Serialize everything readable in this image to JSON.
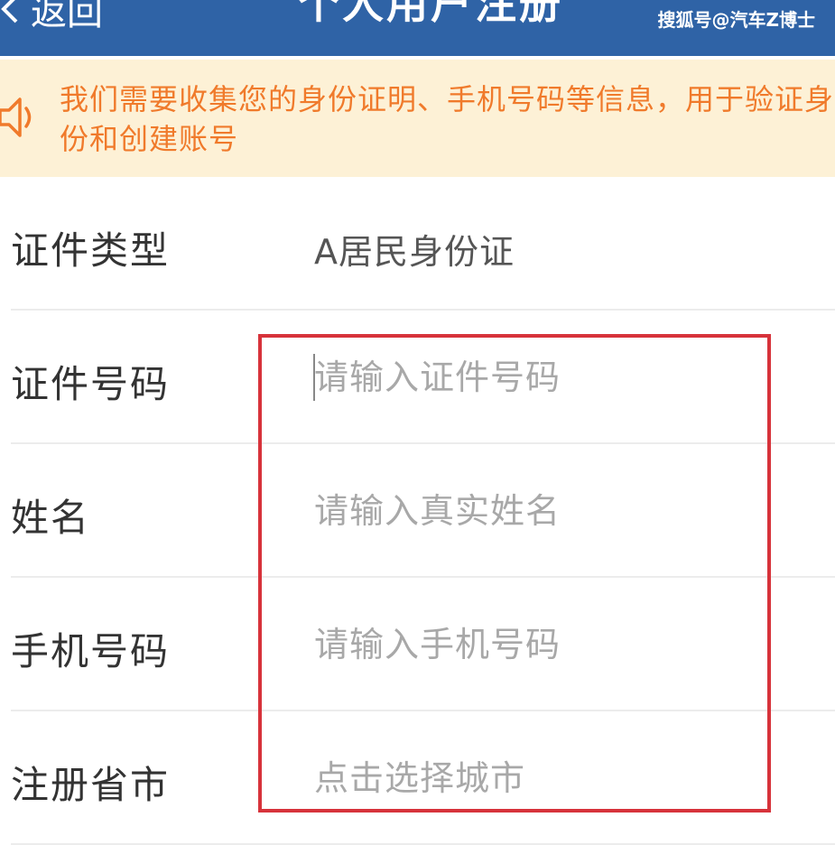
{
  "header": {
    "back_label": "返回",
    "title": "个人用户注册",
    "watermark": "搜狐号@汽车Z博士",
    "background_color": "#2f63a6"
  },
  "notice": {
    "text": "我们需要收集您的身份证明、手机号码等信息，用于验证身份和创建账号",
    "icon": "speaker-icon",
    "text_color": "#f07a2b",
    "background_color": "#fdf1d6"
  },
  "form": {
    "id_type": {
      "label": "证件类型",
      "value": "A居民身份证"
    },
    "id_number": {
      "label": "证件号码",
      "placeholder": "请输入证件号码"
    },
    "name": {
      "label": "姓名",
      "placeholder": "请输入真实姓名"
    },
    "phone": {
      "label": "手机号码",
      "placeholder": "请输入手机号码"
    },
    "city": {
      "label": "注册省市",
      "placeholder": "点击选择城市"
    }
  },
  "annotation": {
    "highlight_color": "#d7333b"
  }
}
